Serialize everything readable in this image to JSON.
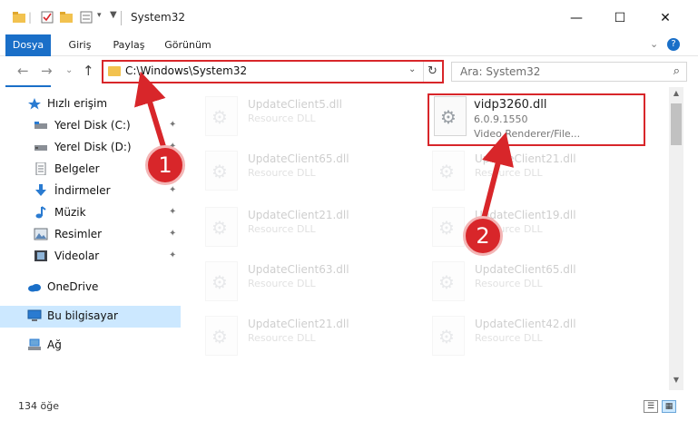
{
  "window": {
    "title": "System32",
    "minimize": "—",
    "maximize": "☐",
    "close": "✕"
  },
  "ribbon": {
    "tabs": [
      "Dosya",
      "Giriş",
      "Paylaş",
      "Görünüm"
    ],
    "expand": "⌄",
    "help": "?"
  },
  "nav": {
    "back": "←",
    "forward": "→",
    "recent": "⌄",
    "up": "↑",
    "address": "C:\\Windows\\System32",
    "address_chevron": "⌄",
    "refresh": "↻",
    "search_placeholder": "Ara: System32",
    "search_icon": "⌕"
  },
  "sidebar": {
    "items": [
      {
        "label": "Hızlı erişim",
        "icon": "star-icon"
      },
      {
        "label": "Yerel Disk (C:)",
        "icon": "drive-icon",
        "pinned": true
      },
      {
        "label": "Yerel Disk (D:)",
        "icon": "drive-icon",
        "pinned": true
      },
      {
        "label": "Belgeler",
        "icon": "documents-icon",
        "pinned": true
      },
      {
        "label": "İndirmeler",
        "icon": "downloads-icon",
        "pinned": true
      },
      {
        "label": "Müzik",
        "icon": "music-icon",
        "pinned": true
      },
      {
        "label": "Resimler",
        "icon": "pictures-icon",
        "pinned": true
      },
      {
        "label": "Videolar",
        "icon": "videos-icon",
        "pinned": true
      },
      {
        "label": "OneDrive",
        "icon": "cloud-icon"
      },
      {
        "label": "Bu bilgisayar",
        "icon": "computer-icon",
        "selected": true
      },
      {
        "label": "Ağ",
        "icon": "network-icon"
      }
    ],
    "pin_glyph": "📌"
  },
  "files": {
    "left_column": [
      {
        "name": "UpdateClient5.dll",
        "desc": "Resource DLL"
      },
      {
        "name": "UpdateClient65.dll",
        "desc": "Resource DLL"
      },
      {
        "name": "UpdateClient21.dll",
        "desc": "Resource DLL"
      },
      {
        "name": "UpdateClient63.dll",
        "desc": "Resource DLL"
      },
      {
        "name": "UpdateClient21.dll",
        "desc": "Resource DLL"
      }
    ],
    "right_column": [
      {
        "name": "vidp3260.dll",
        "version": "6.0.9.1550",
        "desc": "Video Renderer/File..."
      },
      {
        "name": "UpdateClient21.dll",
        "desc": "Resource DLL"
      },
      {
        "name": "UpdateClient19.dll",
        "desc": "Resource DLL"
      },
      {
        "name": "UpdateClient65.dll",
        "desc": "Resource DLL"
      },
      {
        "name": "UpdateClient42.dll",
        "desc": "Resource DLL"
      }
    ]
  },
  "status": {
    "count_text": "134 öğe"
  },
  "annotations": {
    "badge1": "1",
    "badge2": "2",
    "color": "#d8262a"
  }
}
